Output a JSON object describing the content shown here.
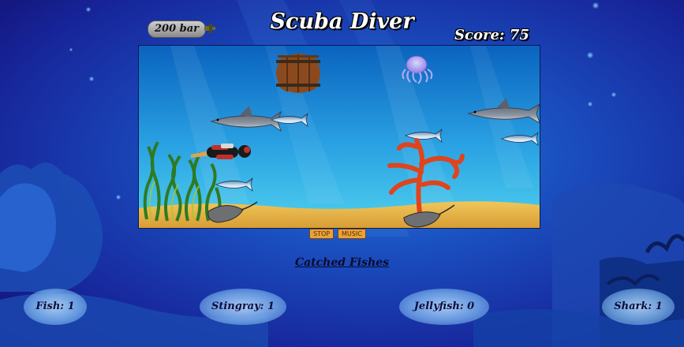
{
  "header": {
    "title": "Scuba Diver",
    "tank_label": "200 bar",
    "score_label": "Score: 75"
  },
  "controls": {
    "stop_label": "STOP",
    "music_label": "MUSIC"
  },
  "catched": {
    "heading": "Catched Fishes",
    "fish": "Fish: 1",
    "stingray": "Stingray: 1",
    "jellyfish": "Jellyfish: 0",
    "shark": "Shark: 1"
  },
  "colors": {
    "water_top": "#0d6fc4",
    "water_bottom": "#4fd1f0",
    "sand": "#e6b84a",
    "coral": "#e0441c",
    "seaweed": "#3a8a2a"
  }
}
